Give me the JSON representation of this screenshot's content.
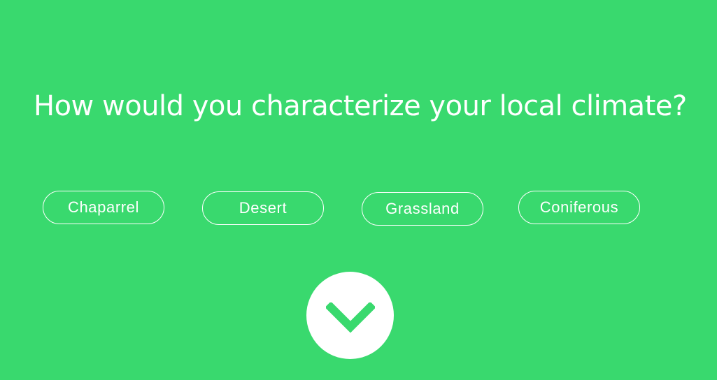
{
  "question": {
    "text": "How would you characterize your local climate?"
  },
  "options": [
    {
      "label": "Chaparrel"
    },
    {
      "label": "Desert"
    },
    {
      "label": "Grassland"
    },
    {
      "label": "Coniferous"
    }
  ],
  "next_button": {
    "icon": "chevron-down-icon"
  },
  "colors": {
    "background": "#39d96e",
    "foreground": "#ffffff"
  }
}
